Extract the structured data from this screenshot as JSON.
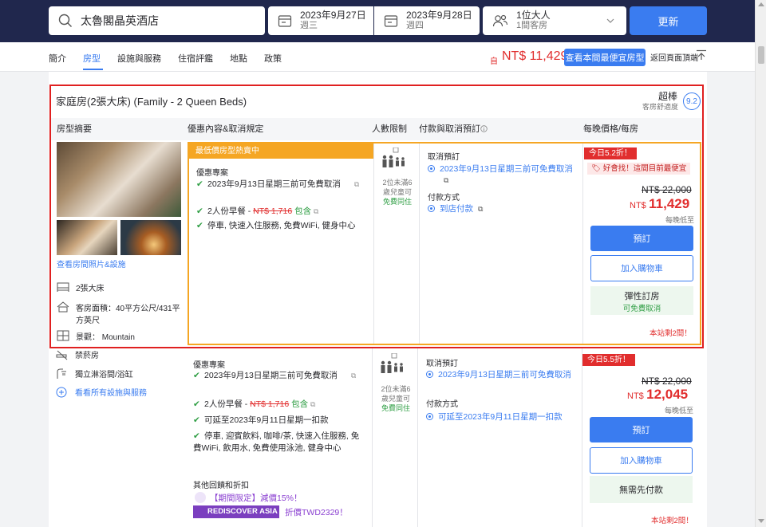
{
  "search": {
    "hotel": "太魯閣晶英酒店"
  },
  "dates": {
    "checkin": {
      "date": "2023年9月27日",
      "weekday": "週三"
    },
    "checkout": {
      "date": "2023年9月28日",
      "weekday": "週四"
    }
  },
  "guests": {
    "adults": "1位大人",
    "rooms": "1間客房"
  },
  "update_label": "更新",
  "tabs": [
    "簡介",
    "房型",
    "設施與服務",
    "住宿評鑑",
    "地點",
    "政策"
  ],
  "nav": {
    "price_from_label": "自",
    "price": "NT$ 11,429",
    "cheapest_label": "查看本間最便宜房型",
    "back_top_label": "返回頁面頂端"
  },
  "room": {
    "title": "家庭房(2張大床) (Family - 2 Queen Beds)",
    "rating_word": "超棒",
    "rating_sub": "客房舒適度",
    "rating_score": "9.2",
    "col_headers": {
      "summary": "房型摘要",
      "offer": "優惠內容&取消規定",
      "capacity": "人數限制",
      "payment": "付款與取消預訂",
      "price": "每晚價格/每房"
    },
    "photo_link": "查看房間照片&設施",
    "amenities": [
      "2張大床",
      "客房面積：40平方公尺/431平方英尺",
      "景觀： Mountain"
    ],
    "hot_tag": "最低價房型熱賣中",
    "perk_head": "優惠專案",
    "perks": {
      "cancel": "2023年9月13日星期三前可免費取消",
      "breakfast_prefix": "2人份早餐 - ",
      "breakfast_old": "NT$ 1,716",
      "breakfast_included": "包含",
      "services": "停車, 快速入住服務, 免費WiFi, 健身中心"
    },
    "capacity_text": "2位未滿6歲兒童可",
    "capacity_free": "免費同住",
    "payment": {
      "cancel_head": "取消預訂",
      "cancel_item": "2023年9月13日星期三前可免費取消",
      "method_head": "付款方式",
      "method_item": "到店付款"
    },
    "discount": "今日5.2折！",
    "promo": "好會找！這間目前最便宜",
    "old_price": "NT$ 22,000",
    "currency": "NT$",
    "new_price": "11,429",
    "per_night": "每晚低至",
    "book_label": "預訂",
    "cart_label": "加入購物車",
    "flex_title": "彈性訂房",
    "flex_sub": "可免費取消",
    "rooms_left": "本站剩2間！"
  },
  "rate2": {
    "left_amenities": [
      "禁菸房",
      "獨立淋浴間/浴缸",
      "看看所有設施與服務"
    ],
    "perk_head": "優惠專案",
    "perks": {
      "cancel": "2023年9月13日星期三前可免費取消",
      "breakfast_prefix": "2人份早餐 - ",
      "breakfast_old": "NT$ 1,716",
      "breakfast_included": "包含",
      "deferred": "可延至2023年9月11日星期一扣款",
      "services": "停車, 迎賓飲料, 咖啡/茶, 快速入住服務, 免費WiFi, 飲用水, 免費使用泳池, 健身中心"
    },
    "capacity_text": "2位未滿6歲兒童可",
    "capacity_free": "免費同住",
    "payment": {
      "cancel_head": "取消預訂",
      "cancel_item": "2023年9月13日星期三前可免費取消",
      "method_head": "付款方式",
      "method_item": "可延至2023年9月11日星期一扣款"
    },
    "extra_head": "其他回饋和折扣",
    "coupon": "【期間限定】減價15%！",
    "rediscover_badge": "REDISCOVER ASIA",
    "rediscover_text": "折價TWD2329！",
    "discount": "今日5.5折！",
    "old_price": "NT$ 22,000",
    "currency": "NT$",
    "new_price": "12,045",
    "per_night": "每晚低至",
    "book_label": "預訂",
    "cart_label": "加入購物車",
    "no_prepay": "無需先付款",
    "rooms_left": "本站剩2間！"
  },
  "colors": {
    "navy": "#20274d",
    "accent": "#3a7cf0",
    "price_red": "#e12d2d",
    "deal_orange": "#f5a623",
    "green": "#2f9e44"
  }
}
